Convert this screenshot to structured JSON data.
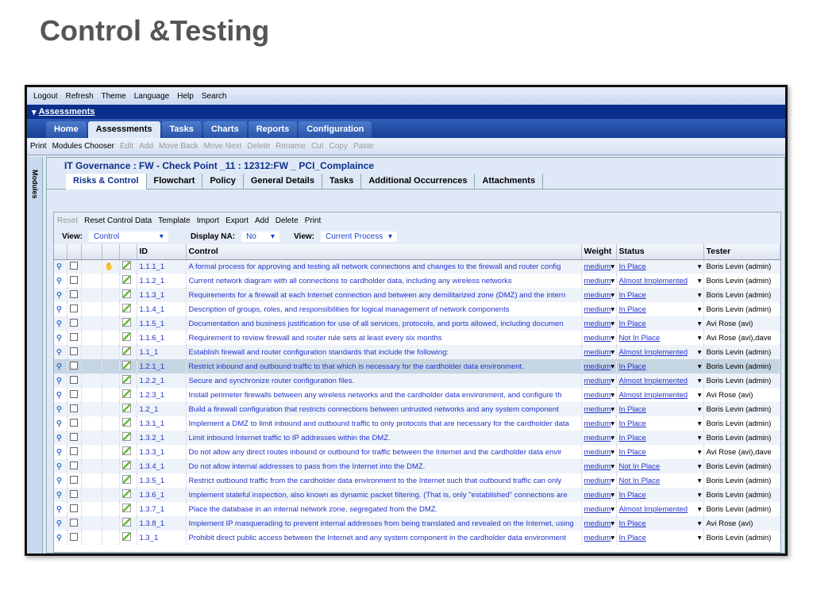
{
  "page_title": "Control &Testing",
  "topbar": [
    "Logout",
    "Refresh",
    "Theme",
    "Language",
    "Help",
    "Search"
  ],
  "section": "Assessments",
  "tabs": [
    "Home",
    "Assessments",
    "Tasks",
    "Charts",
    "Reports",
    "Configuration"
  ],
  "tools": [
    "Print",
    "Modules Chooser",
    "Edit",
    "Add",
    "Move Back",
    "Move Next",
    "Delete",
    "Rename",
    "Cut",
    "Copy",
    "Paste"
  ],
  "side_label": "Modules",
  "breadcrumb": "IT Governance : FW - Check Point _11 : 12312:FW _ PCI_Complaince",
  "subtabs": [
    "Risks & Control",
    "Flowchart",
    "Policy",
    "General Details",
    "Tasks",
    "Additional Occurrences",
    "Attachments"
  ],
  "grid_tools": [
    "Reset",
    "Reset Control Data",
    "Template",
    "Import",
    "Export",
    "Add",
    "Delete",
    "Print"
  ],
  "views": {
    "view_label": "View:",
    "view_value": "Control",
    "na_label": "Display NA:",
    "na_value": "No",
    "view2_label": "View:",
    "view2_value": "Current Process"
  },
  "columns": [
    "ID",
    "Control",
    "Weight",
    "Status",
    "Tester"
  ],
  "rows": [
    {
      "id": "1.1.1_1",
      "control": "A formal process for approving and testing all network connections and changes to the firewall and router config",
      "weight": "medium",
      "status": "In Place",
      "tester": "Boris Levin (admin)",
      "flag": true
    },
    {
      "id": "1.1.2_1",
      "control": "Current network diagram with all connections to cardholder data, including any wireless networks",
      "weight": "medium",
      "status": "Almost Implemented",
      "tester": "Boris Levin (admin)"
    },
    {
      "id": "1.1.3_1",
      "control": "Requirements for a firewall at each Internet connection and between any demilitarized zone (DMZ) and the intern",
      "weight": "medium",
      "status": "In Place",
      "tester": "Boris Levin (admin)"
    },
    {
      "id": "1.1.4_1",
      "control": "Description of groups, roles, and responsibilities for logical management of network components",
      "weight": "medium",
      "status": "In Place",
      "tester": "Boris Levin (admin)"
    },
    {
      "id": "1.1.5_1",
      "control": "Documentation and business justification for use of all services, protocols, and ports allowed, including documen",
      "weight": "medium",
      "status": "In Place",
      "tester": "Avi Rose (avi)"
    },
    {
      "id": "1.1.6_1",
      "control": "Requirement to review firewall and router rule sets at least every six months",
      "weight": "medium",
      "status": "Not In Place",
      "tester": "Avi Rose (avi),dave"
    },
    {
      "id": "1.1_1",
      "control": "Establish firewall and router configuration standards that include the following:",
      "weight": "medium",
      "status": "Almost Implemented",
      "tester": "Boris Levin (admin)"
    },
    {
      "id": "1.2.1_1",
      "control": "Restrict inbound and outbound traffic to that which is necessary for the cardholder data environment.",
      "weight": "medium",
      "status": "In Place",
      "tester": "Boris Levin (admin)",
      "selected": true
    },
    {
      "id": "1.2.2_1",
      "control": "Secure and synchronize router configuration files.",
      "weight": "medium",
      "status": "Almost Implemented",
      "tester": "Boris Levin (admin)"
    },
    {
      "id": "1.2.3_1",
      "control": "Install perimeter firewalls between any wireless networks and the cardholder data environment, and configure th",
      "weight": "medium",
      "status": "Almost Implemented",
      "tester": "Avi Rose (avi)"
    },
    {
      "id": "1.2_1",
      "control": "Build a firewall configuration that restricts connections between untrusted networks and any system component",
      "weight": "medium",
      "status": "In Place",
      "tester": "Boris Levin (admin)"
    },
    {
      "id": "1.3.1_1",
      "control": "Implement a DMZ to limit inbound and outbound traffic to only protocols that are necessary for the cardholder data",
      "weight": "medium",
      "status": "In Place",
      "tester": "Boris Levin (admin)"
    },
    {
      "id": "1.3.2_1",
      "control": "Limit inbound Internet traffic to IP addresses within the DMZ.",
      "weight": "medium",
      "status": "In Place",
      "tester": "Boris Levin (admin)"
    },
    {
      "id": "1.3.3_1",
      "control": "Do not allow any direct routes inbound or outbound for traffic between the Internet and the cardholder data envir",
      "weight": "medium",
      "status": "In Place",
      "tester": "Avi Rose (avi),dave"
    },
    {
      "id": "1.3.4_1",
      "control": "Do not allow internal addresses to pass from the Internet into the DMZ.",
      "weight": "medium",
      "status": "Not In Place",
      "tester": "Boris Levin (admin)"
    },
    {
      "id": "1.3.5_1",
      "control": "Restrict outbound traffic from the cardholder data environment to the Internet such that outbound traffic can only",
      "weight": "medium",
      "status": "Not In Place",
      "tester": "Boris Levin (admin)"
    },
    {
      "id": "1.3.6_1",
      "control": "Implement stateful inspection, also known as dynamic packet filtering. (That is, only \"established\" connections are",
      "weight": "medium",
      "status": "In Place",
      "tester": "Boris Levin (admin)"
    },
    {
      "id": "1.3.7_1",
      "control": "Place the database in an internal network zone, segregated from the DMZ.",
      "weight": "medium",
      "status": "Almost Implemented",
      "tester": "Boris Levin (admin)"
    },
    {
      "id": "1.3.8_1",
      "control": "Implement IP masquerading to prevent internal addresses from being translated and revealed on the Internet, using",
      "weight": "medium",
      "status": "In Place",
      "tester": "Avi Rose (avi)"
    },
    {
      "id": "1.3_1",
      "control": "Prohibit direct public access between the Internet and any system component in the cardholder data environment",
      "weight": "medium",
      "status": "In Place",
      "tester": "Boris Levin (admin)"
    }
  ]
}
